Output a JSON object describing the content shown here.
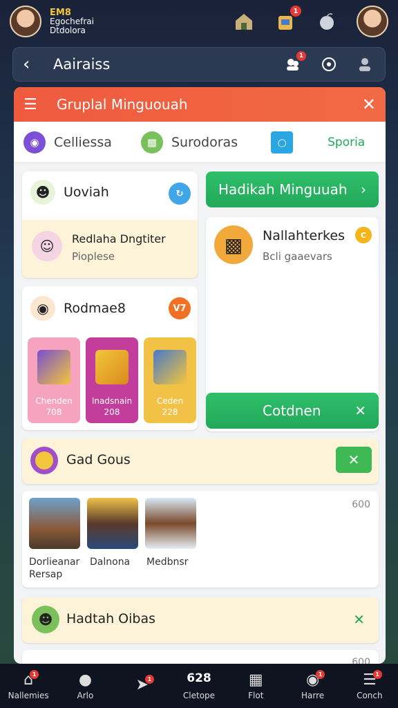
{
  "top": {
    "num": "EM8",
    "line1": "Egochefrai",
    "line2": "Dtdolora"
  },
  "navbar": {
    "title": "Aairaiss"
  },
  "panel": {
    "title": "Gruplal Minguouah",
    "tabs": [
      {
        "label": "Celliessa",
        "color": "#7b4fd6",
        "icon": "B"
      },
      {
        "label": "Surodoras",
        "color": "#7ac15b",
        "icon": "##"
      },
      {
        "label": "Sporia",
        "color": "#2aa6e0",
        "icon": "○"
      }
    ]
  },
  "card_daviah": {
    "title": "Uoviah",
    "sub_title": "Redlaha Dngtiter",
    "sub_text": "Pioplese"
  },
  "card_rednaes": {
    "title": "Rodmae8",
    "badge": "V7",
    "tiles": [
      {
        "name": "Chenden",
        "value": "708",
        "color": "#f6a3c0"
      },
      {
        "name": "Inadsnain",
        "value": "208",
        "color": "#c23e9a"
      },
      {
        "name": "Ceden",
        "value": "228",
        "color": "#f1c246"
      }
    ]
  },
  "right": {
    "banner": "Hadikah Minguuah",
    "item_title": "Nallahterkes",
    "item_sub": "Bcli gaaevars",
    "cta": "Cotdnen"
  },
  "gadgous": {
    "title": "Gad Gous"
  },
  "gallery": {
    "count": "600",
    "items": [
      {
        "caption": "Dorlieanar Rersap"
      },
      {
        "caption": "Dalnona"
      },
      {
        "caption": "Medbnsr"
      }
    ]
  },
  "hadtah": {
    "title": "Hadtah Oibas"
  },
  "peek": {
    "count": "600"
  },
  "bottom_nav": [
    {
      "label": "Nallemies",
      "icon": "home-icon"
    },
    {
      "label": "Arlo",
      "icon": "bag-icon"
    },
    {
      "label": "",
      "icon": "rocket-icon"
    },
    {
      "label": "Cletope",
      "icon": "",
      "top": "628"
    },
    {
      "label": "Flot",
      "icon": "board-icon"
    },
    {
      "label": "Harre",
      "icon": "chat-icon"
    },
    {
      "label": "Conch",
      "icon": "menu-icon"
    }
  ],
  "colors": {
    "accent": "#ef5a3e",
    "green": "#22a85a"
  }
}
